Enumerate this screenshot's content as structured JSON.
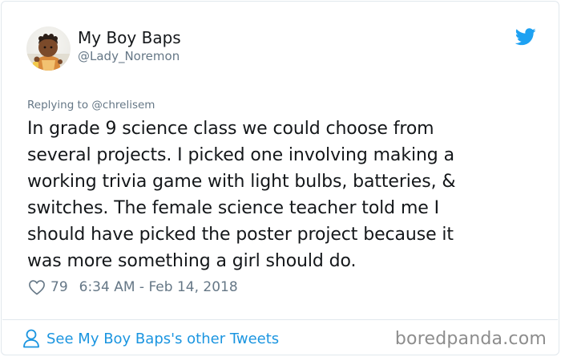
{
  "author": {
    "name": "My Boy Baps",
    "handle": "@Lady_Noremon"
  },
  "tweet": {
    "replying_to": "Replying to @chrelisem",
    "lines": [
      "In grade 9 science class we could choose from",
      "several projects. I picked one involving making a",
      "working trivia game with light bulbs, batteries, &",
      "switches. The female science teacher told me I",
      "should have picked the poster project because it",
      "was more something a girl should do."
    ],
    "likes": "79",
    "timestamp": "6:34 AM - Feb 14, 2018"
  },
  "footer": {
    "see_more_label": "See My Boy Baps's other Tweets",
    "watermark": "boredpanda.com"
  },
  "colors": {
    "twitter_blue": "#1da1f2",
    "link_blue": "#1b95e0",
    "muted": "#657786"
  },
  "icons": {
    "brand": "twitter-bird-icon",
    "like": "heart-icon",
    "profile": "person-icon"
  }
}
